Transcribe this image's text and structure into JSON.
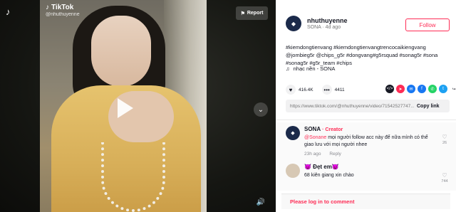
{
  "video": {
    "watermark_title": "TikTok",
    "watermark_user": "@nhuthuyenne",
    "report_label": "Report"
  },
  "author": {
    "username": "nhuthuyenne",
    "display_meta": "SONA · 4d ago",
    "follow_label": "Follow"
  },
  "description": "#kiemdongtienvang #kiemdongtienvangtrencocaikiengvang @jombieg5r @chips_g5r #dongvang#g5rsquad #sonag5r #sona #sonag5r #g5r_team #chips",
  "music": "nhạc nền - SONA",
  "actions": {
    "likes": "416.4K",
    "comments": "4411"
  },
  "share_colors": {
    "embed": "#161823",
    "send": "#fe2c55",
    "messenger": "#1877f2",
    "facebook": "#1877f2",
    "whatsapp": "#25d366",
    "twitter": "#1da1f2"
  },
  "link": {
    "url": "https://www.tiktok.com/@nhuthuyenne/video/71542527747...",
    "copy_label": "Copy link"
  },
  "comments": [
    {
      "name": "SONA",
      "creator_badge": "· Creator",
      "mention": "@Sonane",
      "text": " mọi người follow acc này để nữa mình có thể giao lưu với mọi người nhee",
      "time": "23h ago",
      "reply_label": "Reply",
      "likes": "26"
    },
    {
      "name": "😈 Đẹt em😈",
      "text": "68 kiên giang xin chào",
      "likes": "744"
    }
  ],
  "login_prompt": "Please log in to comment"
}
